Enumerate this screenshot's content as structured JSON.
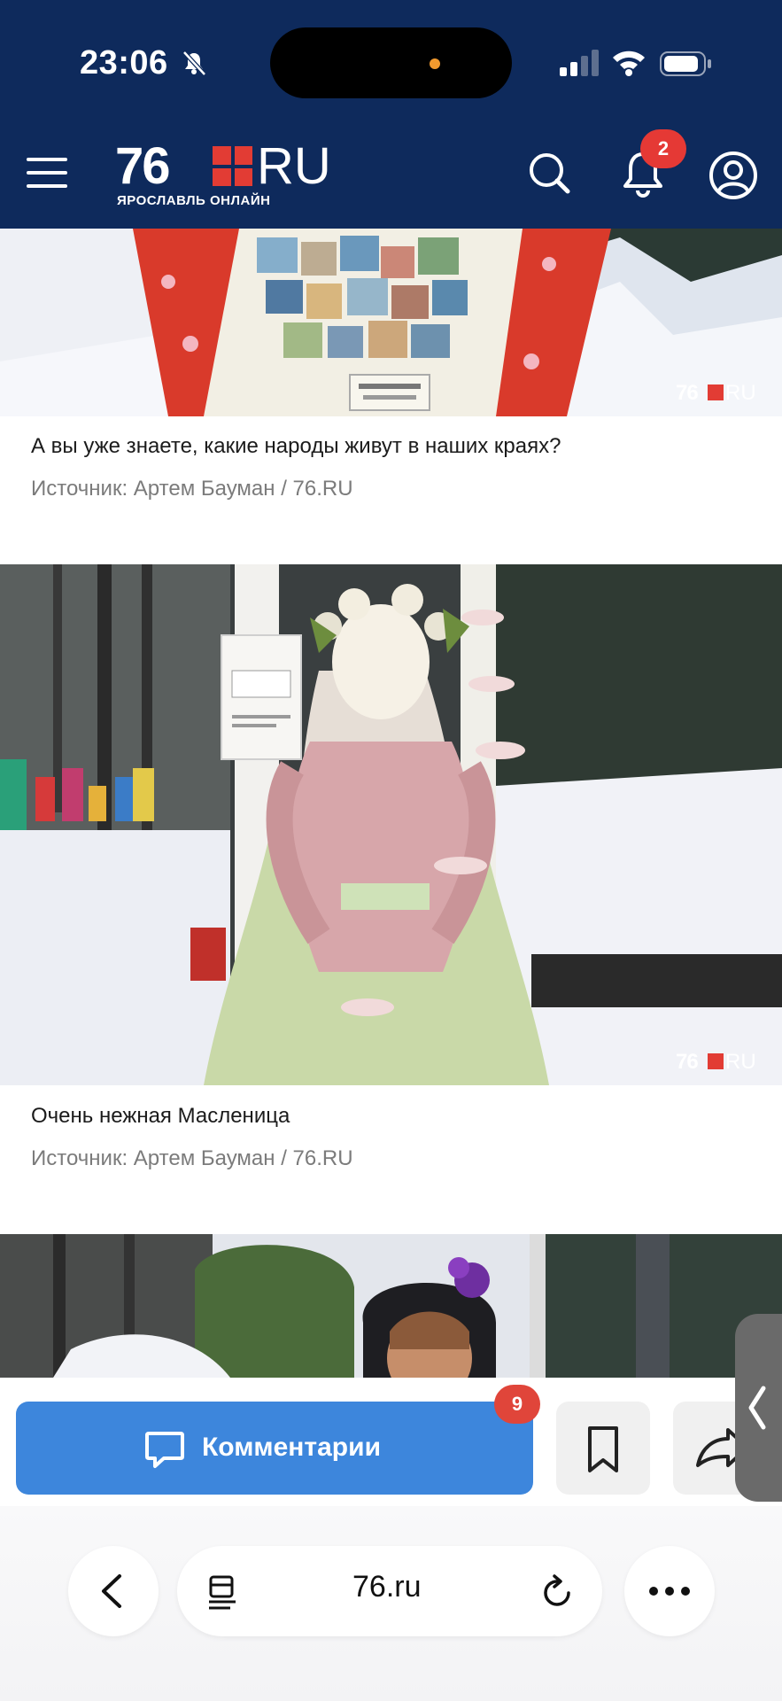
{
  "status_bar": {
    "time": "23:06"
  },
  "header": {
    "logo_number": "76",
    "logo_suffix": "RU",
    "logo_tagline": "ЯРОСЛАВЛЬ ОНЛАЙН",
    "notification_count": "2"
  },
  "gallery": [
    {
      "caption": "А вы уже знаете, какие народы живут в наших краях?",
      "source": "Источник: Артем Бауман / 76.RU"
    },
    {
      "caption": "Очень нежная Масленица",
      "source": "Источник: Артем Бауман / 76.RU"
    }
  ],
  "watermark": {
    "number": "76",
    "suffix": "RU"
  },
  "article_bar": {
    "comments_label": "Комментарии",
    "comments_count": "9"
  },
  "browser": {
    "url": "76.ru"
  },
  "colors": {
    "header_bg": "#0e2a5c",
    "accent_red": "#e23c34",
    "comments_blue": "#3d86dc"
  }
}
